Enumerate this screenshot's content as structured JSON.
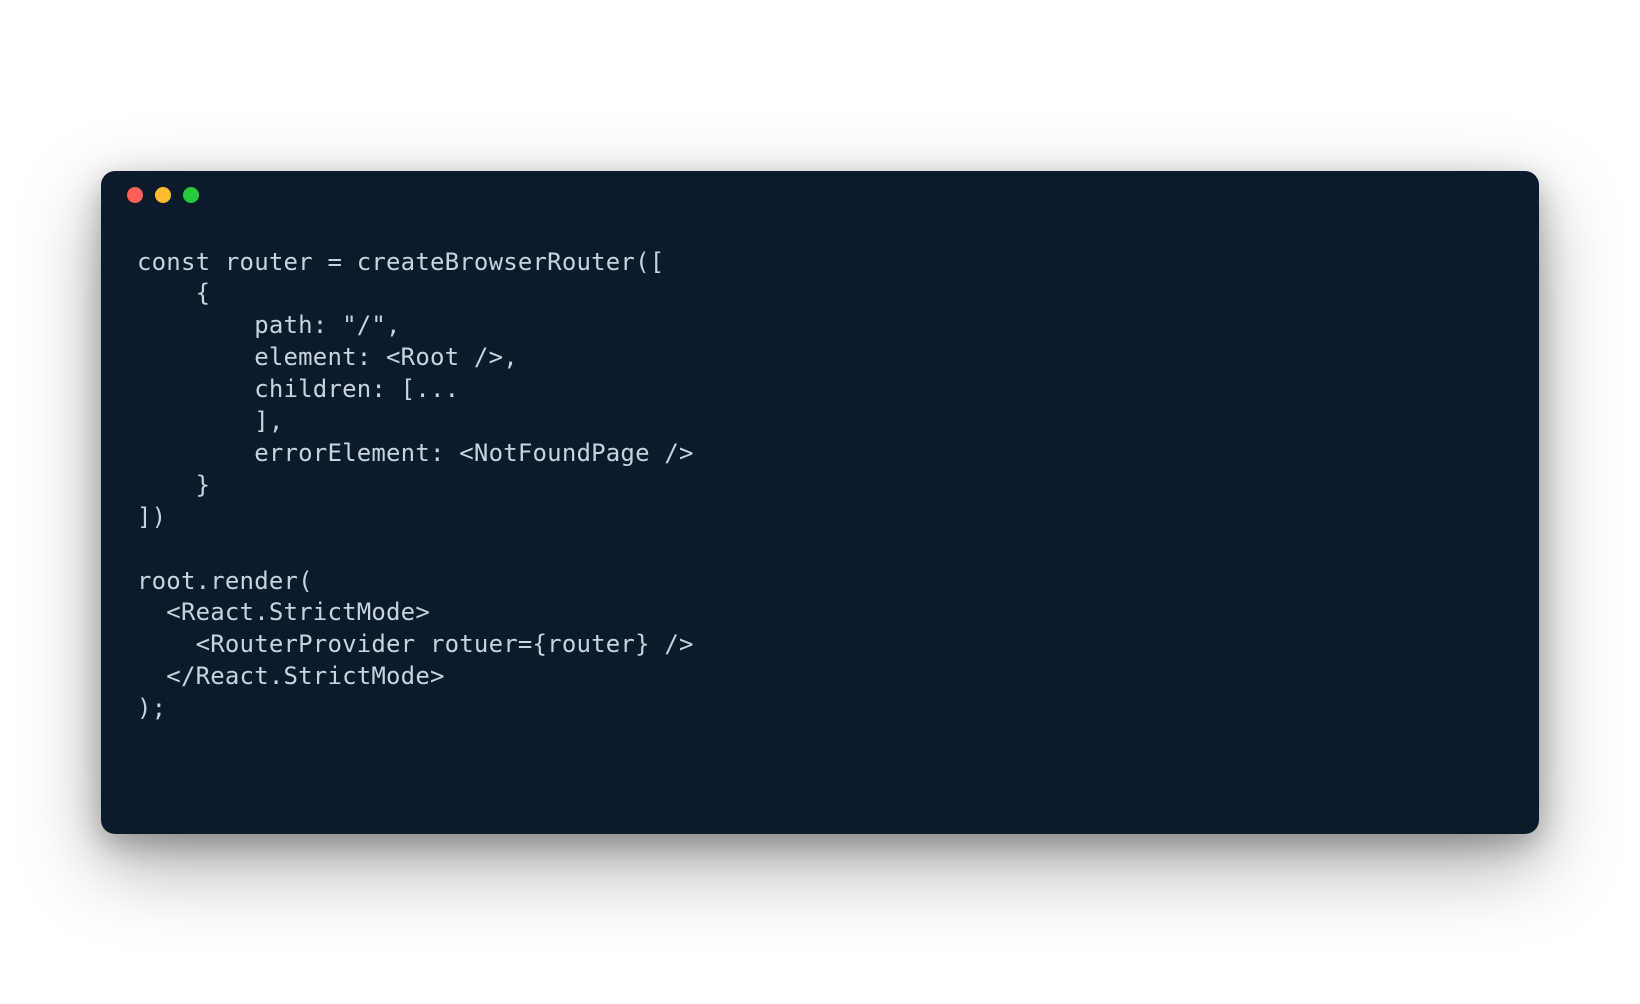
{
  "window": {
    "traffic_lights": {
      "red": "#ff5f56",
      "yellow": "#ffbd2e",
      "green": "#27c93f"
    },
    "background": "#0b1b2b",
    "text_color": "#c8d3e0"
  },
  "code": "const router = createBrowserRouter([\n    {\n        path: \"/\",\n        element: <Root />,\n        children: [...\n        ],\n        errorElement: <NotFoundPage />\n    }\n])\n\nroot.render(\n  <React.StrictMode>\n    <RouterProvider rotuer={router} />\n  </React.StrictMode>\n);"
}
